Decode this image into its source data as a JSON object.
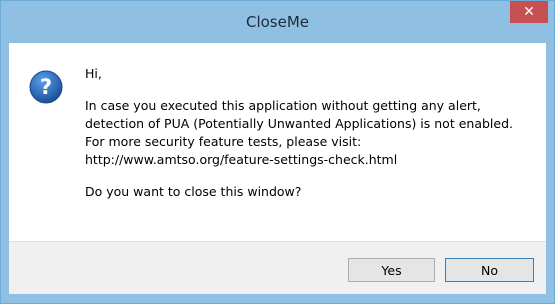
{
  "window": {
    "title": "CloseMe",
    "close_glyph": "✕"
  },
  "dialog": {
    "icon": "question-icon",
    "icon_glyph": "?",
    "greeting": "Hi,",
    "message_lines": [
      "In case you executed this application without getting any alert,",
      "detection of PUA (Potentially Unwanted Applications) is not enabled.",
      "For more security feature tests, please visit:",
      "http://www.amtso.org/feature-settings-check.html"
    ],
    "question": "Do you want to close this window?"
  },
  "buttons": {
    "yes_label": "Yes",
    "no_label": "No"
  },
  "colors": {
    "titlebar": "#8fc0e3",
    "close_button": "#c75050",
    "icon": "#1c5fb0"
  }
}
